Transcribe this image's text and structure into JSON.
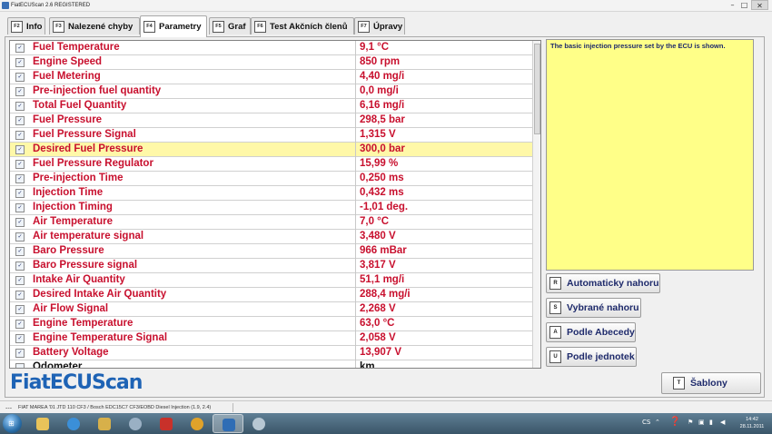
{
  "window": {
    "title": "FiatECUScan 2.6 REGISTERED",
    "min_glyph": "–",
    "max_glyph": "□",
    "close_glyph": "✕"
  },
  "tabs": [
    {
      "key": "F2",
      "label": "Info",
      "active": false
    },
    {
      "key": "F3",
      "label": "Nalezené chyby",
      "active": false
    },
    {
      "key": "F4",
      "label": "Parametry",
      "active": true
    },
    {
      "key": "F5",
      "label": "Graf",
      "active": false
    },
    {
      "key": "F6",
      "label": "Test Akčních členů",
      "active": false
    },
    {
      "key": "F7",
      "label": "Úpravy",
      "active": false
    }
  ],
  "parameters": [
    {
      "name": "Fuel Temperature",
      "value": "9,1 °C",
      "checked": true
    },
    {
      "name": "Engine Speed",
      "value": "850 rpm",
      "checked": true
    },
    {
      "name": "Fuel Metering",
      "value": "4,40 mg/i",
      "checked": true
    },
    {
      "name": "Pre-injection fuel quantity",
      "value": "0,0 mg/i",
      "checked": true
    },
    {
      "name": "Total Fuel Quantity",
      "value": "6,16 mg/i",
      "checked": true
    },
    {
      "name": "Fuel Pressure",
      "value": "298,5 bar",
      "checked": true
    },
    {
      "name": "Fuel Pressure Signal",
      "value": "1,315 V",
      "checked": true
    },
    {
      "name": "Desired Fuel Pressure",
      "value": "300,0 bar",
      "checked": true,
      "selected": true
    },
    {
      "name": "Fuel Pressure Regulator",
      "value": "15,99 %",
      "checked": true
    },
    {
      "name": "Pre-injection Time",
      "value": "0,250 ms",
      "checked": true
    },
    {
      "name": "Injection Time",
      "value": "0,432 ms",
      "checked": true
    },
    {
      "name": "Injection Timing",
      "value": "-1,01 deg.",
      "checked": true
    },
    {
      "name": "Air Temperature",
      "value": "7,0 °C",
      "checked": true
    },
    {
      "name": "Air temperature signal",
      "value": "3,480 V",
      "checked": true
    },
    {
      "name": "Baro Pressure",
      "value": "966 mBar",
      "checked": true
    },
    {
      "name": "Baro Pressure signal",
      "value": "3,817 V",
      "checked": true
    },
    {
      "name": "Intake Air Quantity",
      "value": "51,1 mg/i",
      "checked": true
    },
    {
      "name": "Desired Intake Air Quantity",
      "value": "288,4 mg/i",
      "checked": true
    },
    {
      "name": "Air Flow Signal",
      "value": "2,268 V",
      "checked": true
    },
    {
      "name": "Engine Temperature",
      "value": "63,0 °C",
      "checked": true
    },
    {
      "name": "Engine Temperature Signal",
      "value": "2,058 V",
      "checked": true
    },
    {
      "name": "Battery Voltage",
      "value": "13,907 V",
      "checked": true
    },
    {
      "name": "Odometer",
      "value": "km",
      "checked": false,
      "partial": true
    }
  ],
  "description": "The basic injection pressure set by the ECU is shown.",
  "sort_buttons": [
    {
      "key": "R",
      "label": "Automaticky nahoru"
    },
    {
      "key": "S",
      "label": "Vybrané nahoru"
    },
    {
      "key": "A",
      "label": "Podle Abecedy"
    },
    {
      "key": "U",
      "label": "Podle jednotek"
    }
  ],
  "templates_button": {
    "key": "T",
    "label": "Šablony"
  },
  "logo": "FiatECUScan",
  "status": {
    "left": "---",
    "vehicle": "FIAT MAREA '01 JTD 110 CF3 / Bosch EDC15C7 CF3/EOBD Diesel Injection (1.9, 2.4)"
  },
  "taskbar": {
    "lang": "CS",
    "time": "14:42",
    "date": "28.11.2011"
  },
  "colors": {
    "param_text": "#c8102e",
    "highlight": "#fff8a8",
    "description_bg": "#ffff88",
    "button_text": "#1e2a6b",
    "logo": "#1e63b5"
  }
}
